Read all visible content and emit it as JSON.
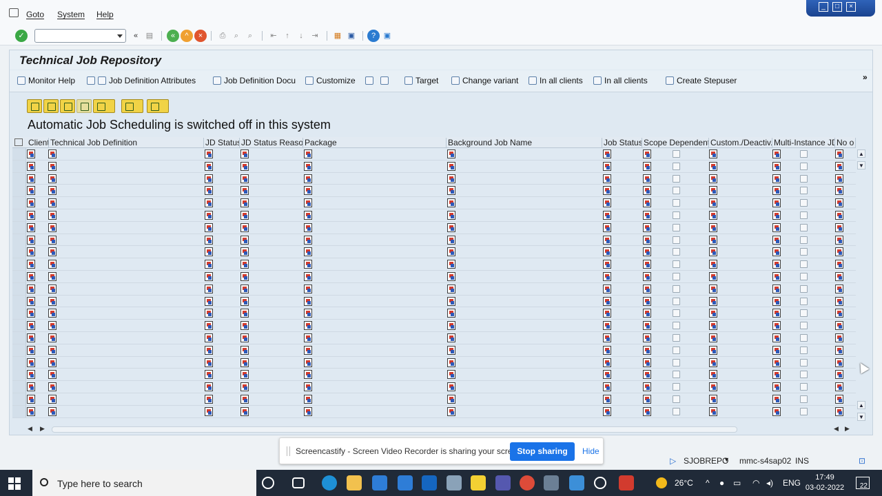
{
  "menubar": {
    "items": [
      "Goto",
      "System",
      "Help"
    ]
  },
  "title": "Technical Job Repository",
  "app_toolbar": {
    "buttons": [
      {
        "label": "Monitor Help",
        "icon": "info-icon"
      },
      {
        "label": "Job Definition Attributes",
        "icon": "refresh-glasses-icon"
      },
      {
        "label": "Job Definition Docu",
        "icon": "docu-icon"
      },
      {
        "label": "Customize",
        "icon": "customize-icon"
      },
      {
        "label": "",
        "icon": "magic-wand-icon"
      },
      {
        "label": "",
        "icon": "undo-icon"
      },
      {
        "label": "Target",
        "icon": "target-icon"
      },
      {
        "label": "Change variant",
        "icon": "change-variant-icon"
      },
      {
        "label": "In all clients",
        "icon": "wand-icon"
      },
      {
        "label": "In all clients",
        "icon": "pencil-icon"
      },
      {
        "label": "Create Stepuser",
        "icon": "user-icon"
      }
    ],
    "more": "»"
  },
  "notice": "Automatic Job Scheduling is switched off in this system",
  "grid": {
    "columns": [
      "Client",
      "Technical Job Definition",
      "JD Status",
      "JD Status Reason",
      "Package",
      "Background Job Name",
      "Job Status",
      "Scope Dependent",
      "Custom./Deactiv.",
      "Multi-Instance JD",
      "No o"
    ],
    "row_count": 22
  },
  "screencastify": {
    "message": "Screencastify - Screen Video Recorder is sharing your screen.",
    "stop_label": "Stop sharing",
    "hide_label": "Hide"
  },
  "status": {
    "program": "SJOBREPO",
    "server": "mmc-s4sap02",
    "mode": "INS"
  },
  "taskbar": {
    "search_placeholder": "Type here to search",
    "weather": "26°C",
    "lang": "ENG",
    "time": "17:49",
    "date": "03-02-2022",
    "notifications": "22"
  },
  "colors": {
    "accent": "#1a73e8",
    "sap_bg": "#dfe9f2",
    "taskbar": "#202a38"
  }
}
